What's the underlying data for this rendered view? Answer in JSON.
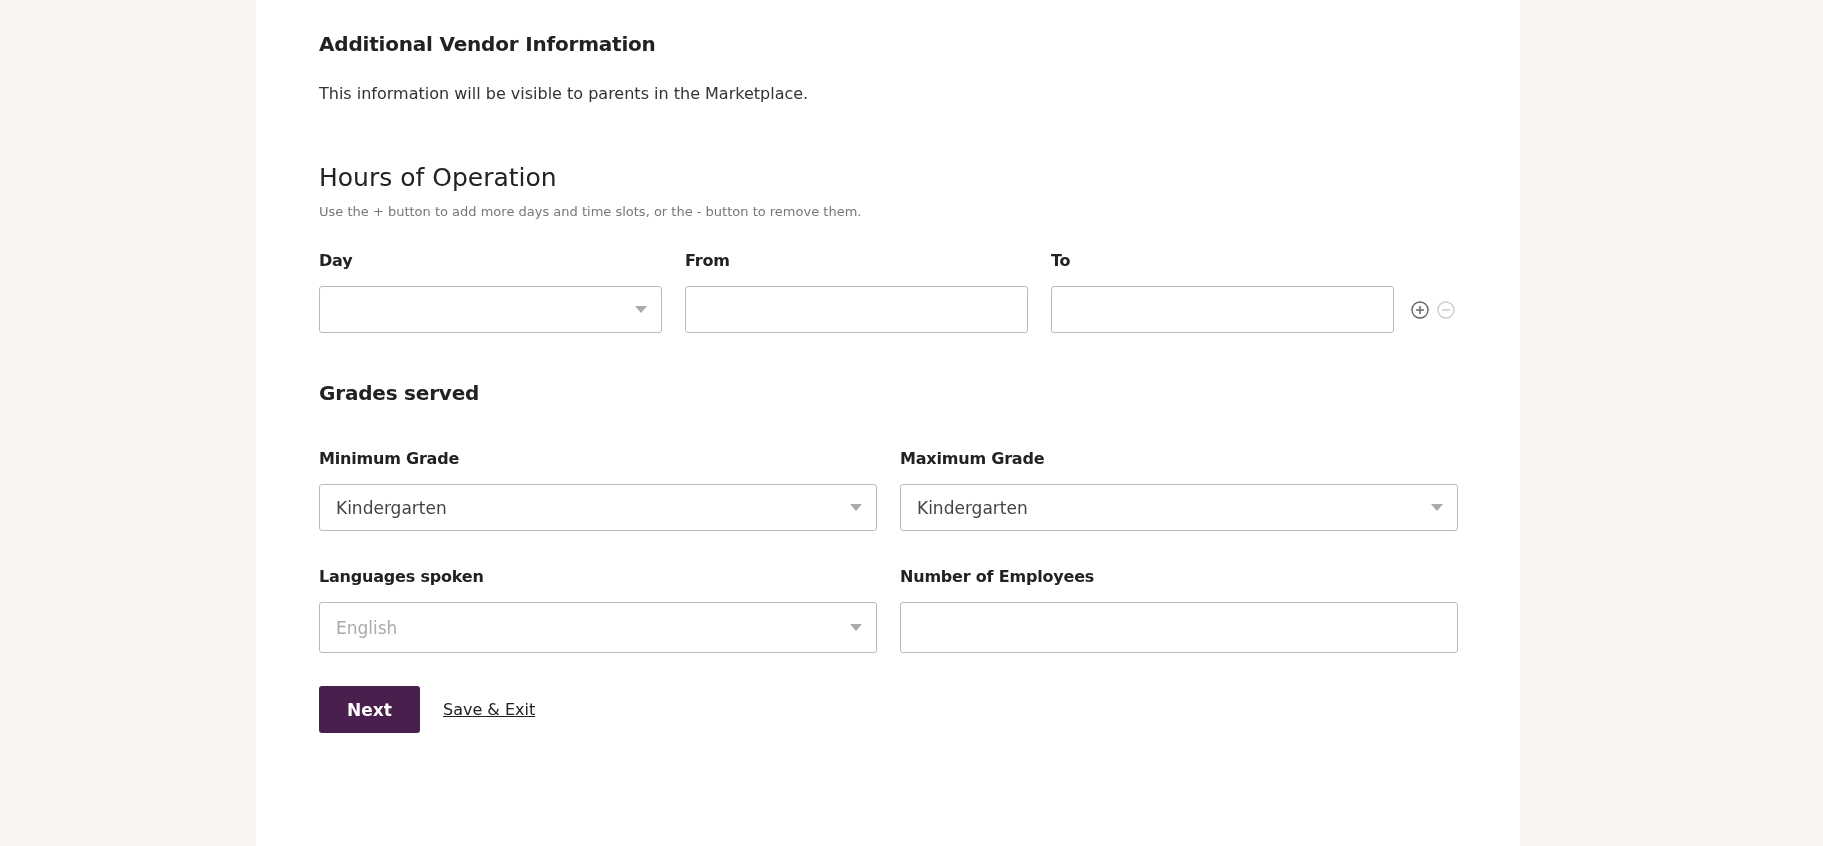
{
  "section": {
    "title": "Additional Vendor Information",
    "description": "This information will be visible to parents in the Marketplace."
  },
  "hours": {
    "title": "Hours of Operation",
    "hint": "Use the + button to add more days and time slots, or the - button to remove them.",
    "fields": [
      {
        "label": "Day",
        "kind": "select"
      },
      {
        "label": "From",
        "kind": "text"
      },
      {
        "label": "To",
        "kind": "text"
      }
    ],
    "add_disabled": false,
    "remove_disabled": true
  },
  "grades": {
    "title": "Grades served",
    "fields": [
      {
        "label": "Minimum Grade",
        "kind": "select",
        "value": "Kindergarten"
      },
      {
        "label": "Maximum Grade",
        "kind": "select",
        "value": "Kindergarten"
      },
      {
        "label": "Languages spoken",
        "kind": "select",
        "placeholder": "English"
      },
      {
        "label": "Number of Employees",
        "kind": "text"
      }
    ]
  },
  "actions": {
    "primary": "Next",
    "secondary": "Save & Exit"
  }
}
